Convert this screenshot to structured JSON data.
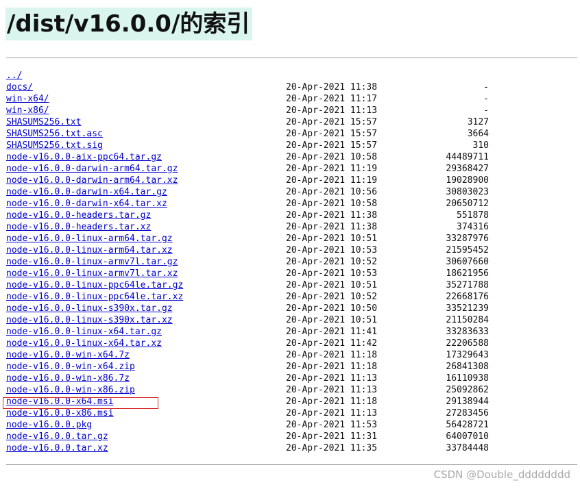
{
  "page": {
    "heading": "/dist/v16.0.0/的索引",
    "parent_link": "../",
    "entries": [
      {
        "name": "docs/",
        "date": "20-Apr-2021 11:38",
        "size": "-"
      },
      {
        "name": "win-x64/",
        "date": "20-Apr-2021 11:17",
        "size": "-"
      },
      {
        "name": "win-x86/",
        "date": "20-Apr-2021 11:13",
        "size": "-"
      },
      {
        "name": "SHASUMS256.txt",
        "date": "20-Apr-2021 15:57",
        "size": "3127"
      },
      {
        "name": "SHASUMS256.txt.asc",
        "date": "20-Apr-2021 15:57",
        "size": "3664"
      },
      {
        "name": "SHASUMS256.txt.sig",
        "date": "20-Apr-2021 15:57",
        "size": "310"
      },
      {
        "name": "node-v16.0.0-aix-ppc64.tar.gz",
        "date": "20-Apr-2021 10:58",
        "size": "44489711"
      },
      {
        "name": "node-v16.0.0-darwin-arm64.tar.gz",
        "date": "20-Apr-2021 11:19",
        "size": "29368427"
      },
      {
        "name": "node-v16.0.0-darwin-arm64.tar.xz",
        "date": "20-Apr-2021 11:19",
        "size": "19028900"
      },
      {
        "name": "node-v16.0.0-darwin-x64.tar.gz",
        "date": "20-Apr-2021 10:56",
        "size": "30803023"
      },
      {
        "name": "node-v16.0.0-darwin-x64.tar.xz",
        "date": "20-Apr-2021 10:58",
        "size": "20650712"
      },
      {
        "name": "node-v16.0.0-headers.tar.gz",
        "date": "20-Apr-2021 11:38",
        "size": "551878"
      },
      {
        "name": "node-v16.0.0-headers.tar.xz",
        "date": "20-Apr-2021 11:38",
        "size": "374316"
      },
      {
        "name": "node-v16.0.0-linux-arm64.tar.gz",
        "date": "20-Apr-2021 10:51",
        "size": "33287976"
      },
      {
        "name": "node-v16.0.0-linux-arm64.tar.xz",
        "date": "20-Apr-2021 10:53",
        "size": "21595452"
      },
      {
        "name": "node-v16.0.0-linux-armv7l.tar.gz",
        "date": "20-Apr-2021 10:52",
        "size": "30607660"
      },
      {
        "name": "node-v16.0.0-linux-armv7l.tar.xz",
        "date": "20-Apr-2021 10:53",
        "size": "18621956"
      },
      {
        "name": "node-v16.0.0-linux-ppc64le.tar.gz",
        "date": "20-Apr-2021 10:51",
        "size": "35271788"
      },
      {
        "name": "node-v16.0.0-linux-ppc64le.tar.xz",
        "date": "20-Apr-2021 10:52",
        "size": "22668176"
      },
      {
        "name": "node-v16.0.0-linux-s390x.tar.gz",
        "date": "20-Apr-2021 10:50",
        "size": "33521239"
      },
      {
        "name": "node-v16.0.0-linux-s390x.tar.xz",
        "date": "20-Apr-2021 10:51",
        "size": "21150284"
      },
      {
        "name": "node-v16.0.0-linux-x64.tar.gz",
        "date": "20-Apr-2021 11:41",
        "size": "33283633"
      },
      {
        "name": "node-v16.0.0-linux-x64.tar.xz",
        "date": "20-Apr-2021 11:42",
        "size": "22206588"
      },
      {
        "name": "node-v16.0.0-win-x64.7z",
        "date": "20-Apr-2021 11:18",
        "size": "17329643"
      },
      {
        "name": "node-v16.0.0-win-x64.zip",
        "date": "20-Apr-2021 11:18",
        "size": "26841308"
      },
      {
        "name": "node-v16.0.0-win-x86.7z",
        "date": "20-Apr-2021 11:13",
        "size": "16110938"
      },
      {
        "name": "node-v16.0.0-win-x86.zip",
        "date": "20-Apr-2021 11:13",
        "size": "25092862"
      },
      {
        "name": "node-v16.0.0-x64.msi",
        "date": "20-Apr-2021 11:18",
        "size": "29138944",
        "highlighted": true
      },
      {
        "name": "node-v16.0.0-x86.msi",
        "date": "20-Apr-2021 11:13",
        "size": "27283456"
      },
      {
        "name": "node-v16.0.0.pkg",
        "date": "20-Apr-2021 11:53",
        "size": "56428721"
      },
      {
        "name": "node-v16.0.0.tar.gz",
        "date": "20-Apr-2021 11:31",
        "size": "64007010"
      },
      {
        "name": "node-v16.0.0.tar.xz",
        "date": "20-Apr-2021 11:35",
        "size": "33784448"
      }
    ]
  },
  "watermark": "CSDN @Double_dddddddd",
  "colors": {
    "link": "#0000cc",
    "heading_bg": "#d9f5ee",
    "highlight_border": "#d92626"
  }
}
